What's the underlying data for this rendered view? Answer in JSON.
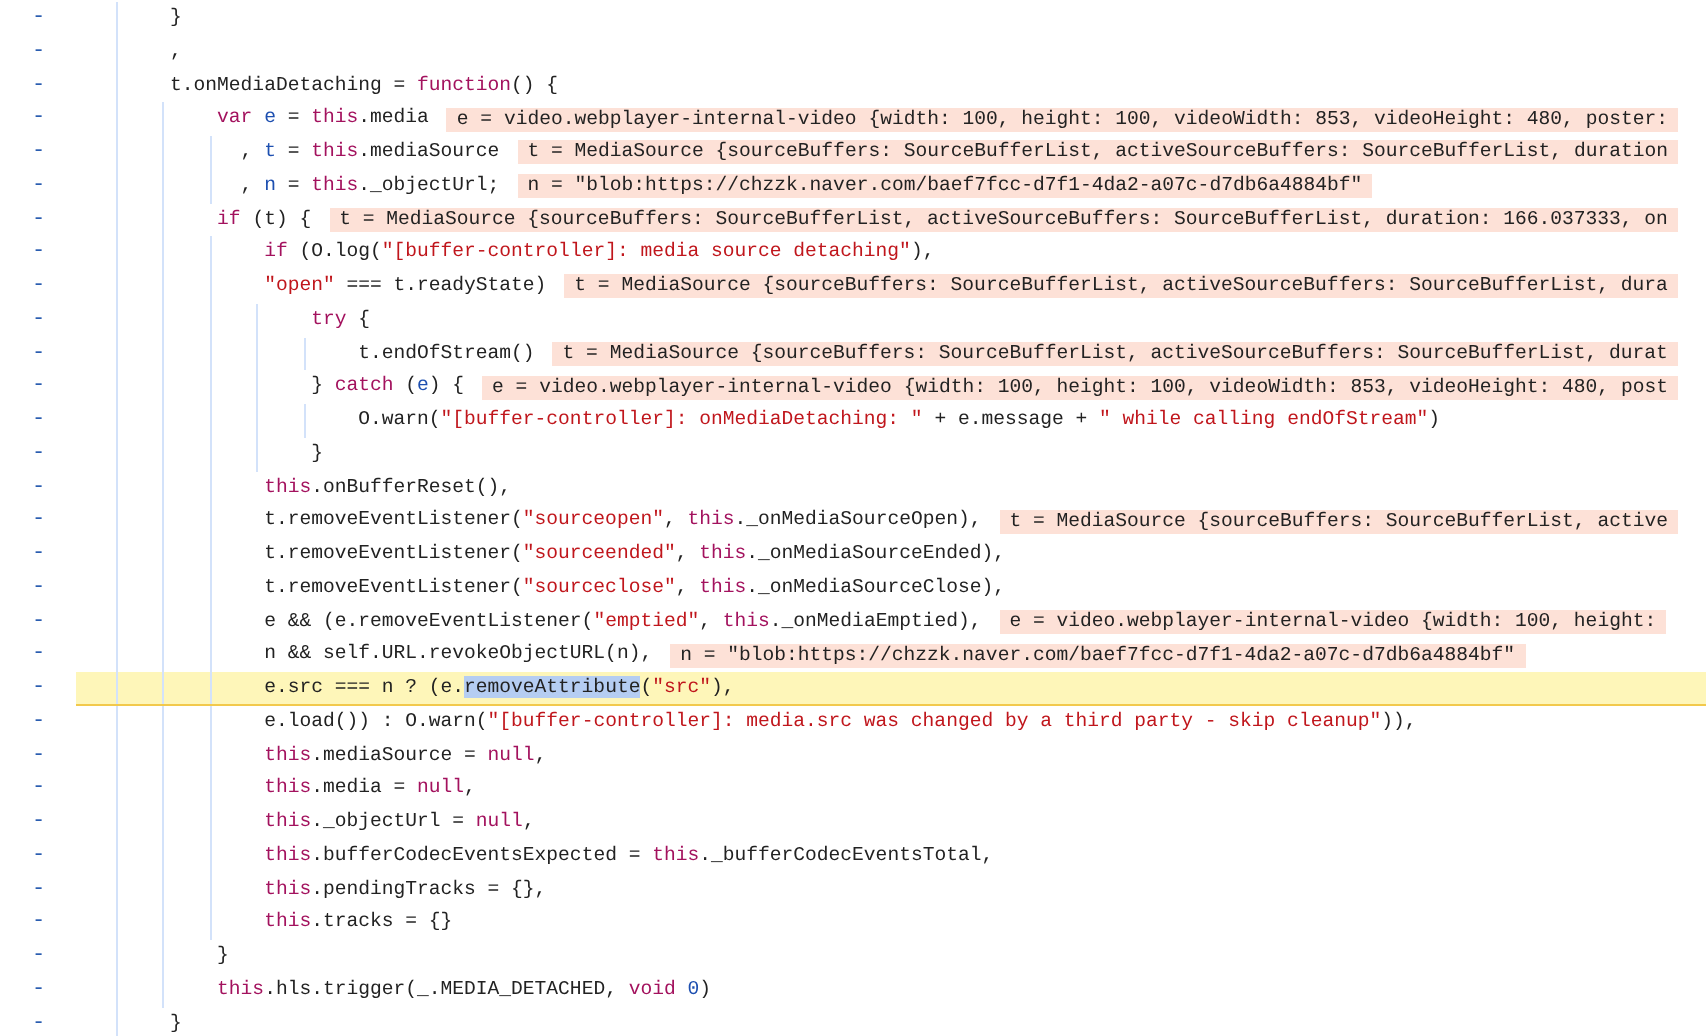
{
  "editor": {
    "lines": [
      {
        "marker": "-",
        "tokens": [
          {
            "text": "        }",
            "kind": "plain"
          }
        ]
      },
      {
        "marker": "-",
        "tokens": [
          {
            "text": "        ,",
            "kind": "plain"
          }
        ]
      },
      {
        "marker": "-",
        "tokens": [
          {
            "text": "        t.onMediaDetaching = ",
            "kind": "plain"
          },
          {
            "text": "function",
            "kind": "keyword"
          },
          {
            "text": "() {",
            "kind": "plain"
          }
        ]
      },
      {
        "marker": "-",
        "tokens": [
          {
            "text": "            var ",
            "kind": "keyword"
          },
          {
            "text": "e",
            "kind": "variable"
          },
          {
            "text": " = ",
            "kind": "plain"
          },
          {
            "text": "this",
            "kind": "keyword"
          },
          {
            "text": ".media",
            "kind": "plain"
          }
        ],
        "value": "e = video.webplayer-internal-video {width: 100, height: 100, videoWidth: 853, videoHeight: 480, poster:"
      },
      {
        "marker": "-",
        "tokens": [
          {
            "text": "              , ",
            "kind": "plain"
          },
          {
            "text": "t",
            "kind": "variable"
          },
          {
            "text": " = ",
            "kind": "plain"
          },
          {
            "text": "this",
            "kind": "keyword"
          },
          {
            "text": ".mediaSource",
            "kind": "plain"
          }
        ],
        "value": "t = MediaSource {sourceBuffers: SourceBufferList, activeSourceBuffers: SourceBufferList, duration"
      },
      {
        "marker": "-",
        "tokens": [
          {
            "text": "              , ",
            "kind": "plain"
          },
          {
            "text": "n",
            "kind": "variable"
          },
          {
            "text": " = ",
            "kind": "plain"
          },
          {
            "text": "this",
            "kind": "keyword"
          },
          {
            "text": "._objectUrl;",
            "kind": "plain"
          }
        ],
        "value": "n = \"blob:https://chzzk.naver.com/baef7fcc-d7f1-4da2-a07c-d7db6a4884bf\""
      },
      {
        "marker": "-",
        "tokens": [
          {
            "text": "            if",
            "kind": "keyword"
          },
          {
            "text": " (t) {",
            "kind": "plain"
          }
        ],
        "value": "t = MediaSource {sourceBuffers: SourceBufferList, activeSourceBuffers: SourceBufferList, duration: 166.037333, on"
      },
      {
        "marker": "-",
        "tokens": [
          {
            "text": "                if",
            "kind": "keyword"
          },
          {
            "text": " (O.log(",
            "kind": "plain"
          },
          {
            "text": "\"[buffer-controller]: media source detaching\"",
            "kind": "string"
          },
          {
            "text": "),",
            "kind": "plain"
          }
        ]
      },
      {
        "marker": "-",
        "tokens": [
          {
            "text": "                \"open\"",
            "kind": "string"
          },
          {
            "text": " === t.readyState)",
            "kind": "plain"
          }
        ],
        "value": "t = MediaSource {sourceBuffers: SourceBufferList, activeSourceBuffers: SourceBufferList, dura"
      },
      {
        "marker": "-",
        "tokens": [
          {
            "text": "                    try",
            "kind": "keyword"
          },
          {
            "text": " {",
            "kind": "plain"
          }
        ]
      },
      {
        "marker": "-",
        "tokens": [
          {
            "text": "                        t.endOfStream()",
            "kind": "plain"
          }
        ],
        "value": "t = MediaSource {sourceBuffers: SourceBufferList, activeSourceBuffers: SourceBufferList, durat"
      },
      {
        "marker": "-",
        "tokens": [
          {
            "text": "                    } ",
            "kind": "plain"
          },
          {
            "text": "catch",
            "kind": "keyword"
          },
          {
            "text": " (",
            "kind": "plain"
          },
          {
            "text": "e",
            "kind": "variable"
          },
          {
            "text": ") {",
            "kind": "plain"
          }
        ],
        "value": "e = video.webplayer-internal-video {width: 100, height: 100, videoWidth: 853, videoHeight: 480, post"
      },
      {
        "marker": "-",
        "tokens": [
          {
            "text": "                        O.warn(",
            "kind": "plain"
          },
          {
            "text": "\"[buffer-controller]: onMediaDetaching: \"",
            "kind": "string"
          },
          {
            "text": " + e.message + ",
            "kind": "plain"
          },
          {
            "text": "\" while calling endOfStream\"",
            "kind": "string"
          },
          {
            "text": ")",
            "kind": "plain"
          }
        ]
      },
      {
        "marker": "-",
        "tokens": [
          {
            "text": "                    }",
            "kind": "plain"
          }
        ]
      },
      {
        "marker": "-",
        "tokens": [
          {
            "text": "                this",
            "kind": "keyword"
          },
          {
            "text": ".onBufferReset(),",
            "kind": "plain"
          }
        ]
      },
      {
        "marker": "-",
        "tokens": [
          {
            "text": "                t.removeEventListener(",
            "kind": "plain"
          },
          {
            "text": "\"sourceopen\"",
            "kind": "string"
          },
          {
            "text": ", ",
            "kind": "plain"
          },
          {
            "text": "this",
            "kind": "keyword"
          },
          {
            "text": "._onMediaSourceOpen),",
            "kind": "plain"
          }
        ],
        "value": "t = MediaSource {sourceBuffers: SourceBufferList, active"
      },
      {
        "marker": "-",
        "tokens": [
          {
            "text": "                t.removeEventListener(",
            "kind": "plain"
          },
          {
            "text": "\"sourceended\"",
            "kind": "string"
          },
          {
            "text": ", ",
            "kind": "plain"
          },
          {
            "text": "this",
            "kind": "keyword"
          },
          {
            "text": "._onMediaSourceEnded),",
            "kind": "plain"
          }
        ]
      },
      {
        "marker": "-",
        "tokens": [
          {
            "text": "                t.removeEventListener(",
            "kind": "plain"
          },
          {
            "text": "\"sourceclose\"",
            "kind": "string"
          },
          {
            "text": ", ",
            "kind": "plain"
          },
          {
            "text": "this",
            "kind": "keyword"
          },
          {
            "text": "._onMediaSourceClose),",
            "kind": "plain"
          }
        ]
      },
      {
        "marker": "-",
        "tokens": [
          {
            "text": "                e && (e.removeEventListener(",
            "kind": "plain"
          },
          {
            "text": "\"emptied\"",
            "kind": "string"
          },
          {
            "text": ", ",
            "kind": "plain"
          },
          {
            "text": "this",
            "kind": "keyword"
          },
          {
            "text": "._onMediaEmptied),",
            "kind": "plain"
          }
        ],
        "value": "e = video.webplayer-internal-video {width: 100, height:"
      },
      {
        "marker": "-",
        "tokens": [
          {
            "text": "                n && self.URL.revokeObjectURL(n),",
            "kind": "plain"
          }
        ],
        "value": "n = \"blob:https://chzzk.naver.com/baef7fcc-d7f1-4da2-a07c-d7db6a4884bf\""
      },
      {
        "marker": "-",
        "current": true,
        "tokens": [
          {
            "text": "                e.src === n ? (e.",
            "kind": "plain"
          },
          {
            "text": "removeAttribute",
            "kind": "selection"
          },
          {
            "text": "(",
            "kind": "plain"
          },
          {
            "text": "\"src\"",
            "kind": "string"
          },
          {
            "text": "),",
            "kind": "plain"
          }
        ]
      },
      {
        "marker": "-",
        "tokens": [
          {
            "text": "                e.load()) : O.warn(",
            "kind": "plain"
          },
          {
            "text": "\"[buffer-controller]: media.src was changed by a third party - skip cleanup\"",
            "kind": "string"
          },
          {
            "text": ")),",
            "kind": "plain"
          }
        ]
      },
      {
        "marker": "-",
        "tokens": [
          {
            "text": "                this",
            "kind": "keyword"
          },
          {
            "text": ".mediaSource = ",
            "kind": "plain"
          },
          {
            "text": "null",
            "kind": "keyword"
          },
          {
            "text": ",",
            "kind": "plain"
          }
        ]
      },
      {
        "marker": "-",
        "tokens": [
          {
            "text": "                this",
            "kind": "keyword"
          },
          {
            "text": ".media = ",
            "kind": "plain"
          },
          {
            "text": "null",
            "kind": "keyword"
          },
          {
            "text": ",",
            "kind": "plain"
          }
        ]
      },
      {
        "marker": "-",
        "tokens": [
          {
            "text": "                this",
            "kind": "keyword"
          },
          {
            "text": "._objectUrl = ",
            "kind": "plain"
          },
          {
            "text": "null",
            "kind": "keyword"
          },
          {
            "text": ",",
            "kind": "plain"
          }
        ]
      },
      {
        "marker": "-",
        "tokens": [
          {
            "text": "                this",
            "kind": "keyword"
          },
          {
            "text": ".bufferCodecEventsExpected = ",
            "kind": "plain"
          },
          {
            "text": "this",
            "kind": "keyword"
          },
          {
            "text": "._bufferCodecEventsTotal,",
            "kind": "plain"
          }
        ]
      },
      {
        "marker": "-",
        "tokens": [
          {
            "text": "                this",
            "kind": "keyword"
          },
          {
            "text": ".pendingTracks = {},",
            "kind": "plain"
          }
        ]
      },
      {
        "marker": "-",
        "tokens": [
          {
            "text": "                this",
            "kind": "keyword"
          },
          {
            "text": ".tracks = {}",
            "kind": "plain"
          }
        ]
      },
      {
        "marker": "-",
        "tokens": [
          {
            "text": "            }",
            "kind": "plain"
          }
        ]
      },
      {
        "marker": "-",
        "tokens": [
          {
            "text": "            this",
            "kind": "keyword"
          },
          {
            "text": ".hls.trigger(_.MEDIA_DETACHED, ",
            "kind": "plain"
          },
          {
            "text": "void ",
            "kind": "keyword"
          },
          {
            "text": "0",
            "kind": "number"
          },
          {
            "text": ")",
            "kind": "plain"
          }
        ]
      },
      {
        "marker": "-",
        "tokens": [
          {
            "text": "        }",
            "kind": "plain"
          }
        ]
      }
    ]
  }
}
